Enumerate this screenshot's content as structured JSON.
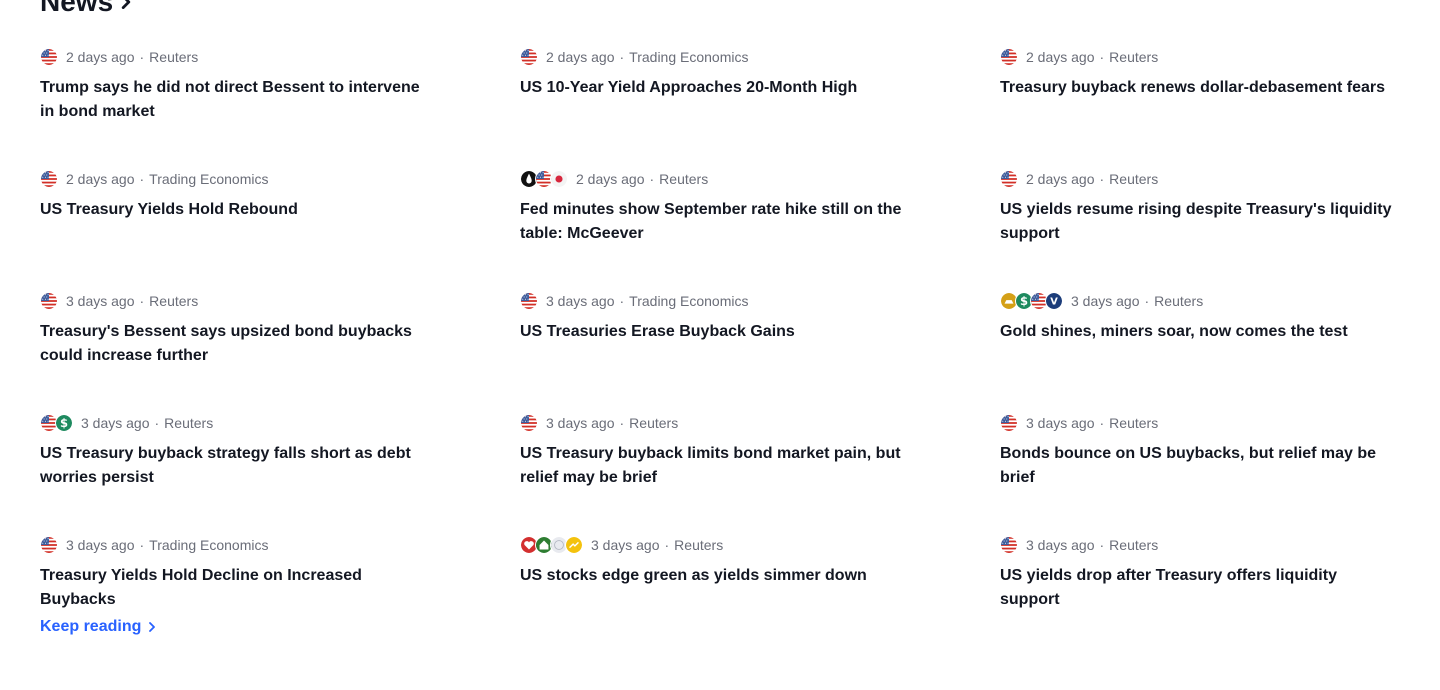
{
  "header": {
    "title": "News"
  },
  "keep_reading": "Keep reading",
  "news": [
    {
      "icons": [
        "flag-us"
      ],
      "time": "2 days ago",
      "source": "Reuters",
      "title": "Trump says he did not direct Bessent to intervene in bond market"
    },
    {
      "icons": [
        "flag-us"
      ],
      "time": "2 days ago",
      "source": "Trading Economics",
      "title": "US 10-Year Yield Approaches 20-Month High"
    },
    {
      "icons": [
        "flag-us"
      ],
      "time": "2 days ago",
      "source": "Reuters",
      "title": "Treasury buyback renews dollar-debasement fears"
    },
    {
      "icons": [
        "flag-us"
      ],
      "time": "2 days ago",
      "source": "Trading Economics",
      "title": "US Treasury Yields Hold Rebound"
    },
    {
      "icons": [
        "oil-drop",
        "flag-us",
        "flag-jp"
      ],
      "time": "2 days ago",
      "source": "Reuters",
      "title": "Fed minutes show September rate hike still on the table: McGeever"
    },
    {
      "icons": [
        "flag-us"
      ],
      "time": "2 days ago",
      "source": "Reuters",
      "title": "US yields resume rising despite Treasury's liquidity support"
    },
    {
      "icons": [
        "flag-us"
      ],
      "time": "3 days ago",
      "source": "Reuters",
      "title": "Treasury's Bessent says upsized bond buybacks could increase further"
    },
    {
      "icons": [
        "flag-us"
      ],
      "time": "3 days ago",
      "source": "Trading Economics",
      "title": "US Treasuries Erase Buyback Gains"
    },
    {
      "icons": [
        "gold-icon",
        "dollar-icon",
        "flag-us",
        "v-icon"
      ],
      "time": "3 days ago",
      "source": "Reuters",
      "title": "Gold shines, miners soar, now comes the test"
    },
    {
      "icons": [
        "flag-us",
        "dollar-icon"
      ],
      "time": "3 days ago",
      "source": "Reuters",
      "title": "US Treasury buyback strategy falls short as debt worries persist"
    },
    {
      "icons": [
        "flag-us"
      ],
      "time": "3 days ago",
      "source": "Reuters",
      "title": "US Treasury buyback limits bond market pain, but relief may be brief"
    },
    {
      "icons": [
        "flag-us"
      ],
      "time": "3 days ago",
      "source": "Reuters",
      "title": "Bonds bounce on US buybacks, but relief may be brief"
    },
    {
      "icons": [
        "flag-us"
      ],
      "time": "3 days ago",
      "source": "Trading Economics",
      "title": "Treasury Yields Hold Decline on Increased Buybacks"
    },
    {
      "icons": [
        "heart-icon",
        "house-icon",
        "globe-icon",
        "chart-up-icon"
      ],
      "time": "3 days ago",
      "source": "Reuters",
      "title": "US stocks edge green as yields simmer down"
    },
    {
      "icons": [
        "flag-us"
      ],
      "time": "3 days ago",
      "source": "Reuters",
      "title": "US yields drop after Treasury offers liquidity support"
    }
  ]
}
